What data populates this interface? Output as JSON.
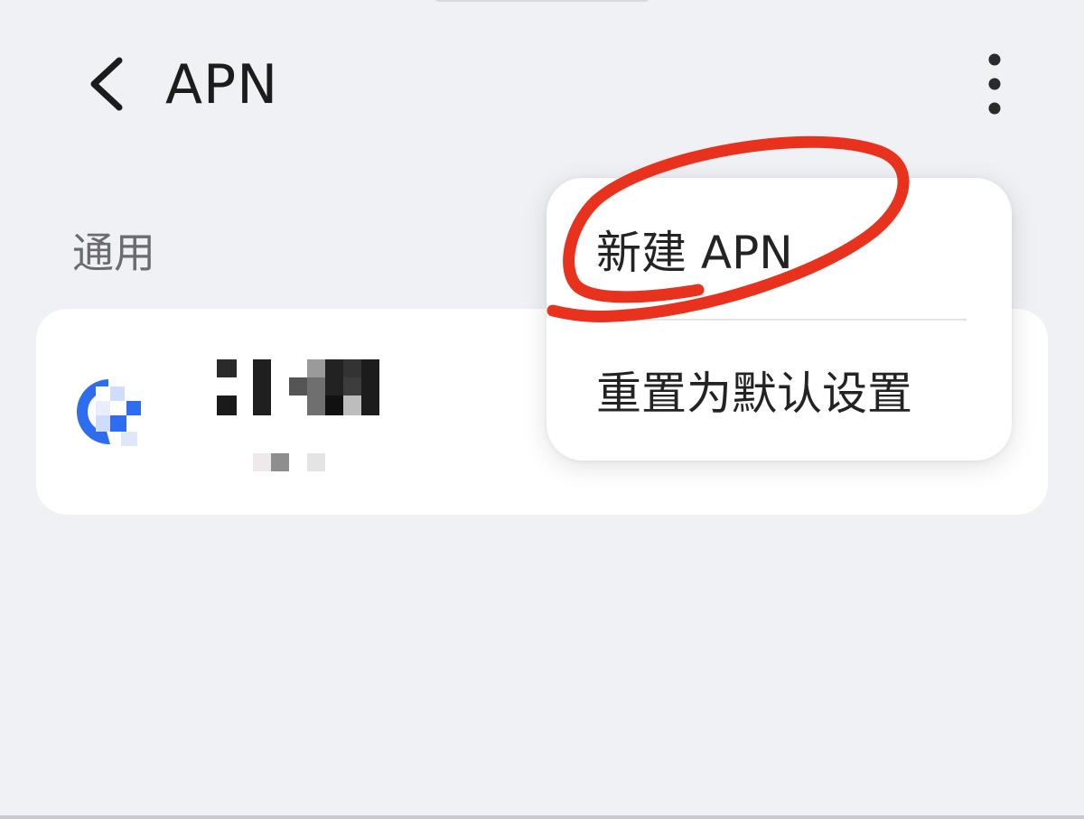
{
  "header": {
    "title": "APN",
    "back_icon": "chevron-left-icon",
    "more_icon": "more-vertical-icon"
  },
  "section": {
    "title": "通用"
  },
  "apn_list": [
    {
      "icon": "carrier-logo-icon",
      "name_redacted": true,
      "subtitle_redacted": true
    }
  ],
  "menu": {
    "items": [
      {
        "label": "新建 APN"
      },
      {
        "label": "重置为默认设置"
      }
    ]
  },
  "colors": {
    "background": "#f0f1f5",
    "card": "#ffffff",
    "annotation_red": "#e8321e",
    "section_text": "#6c6c70",
    "icon_blue": "#2f6df0"
  }
}
